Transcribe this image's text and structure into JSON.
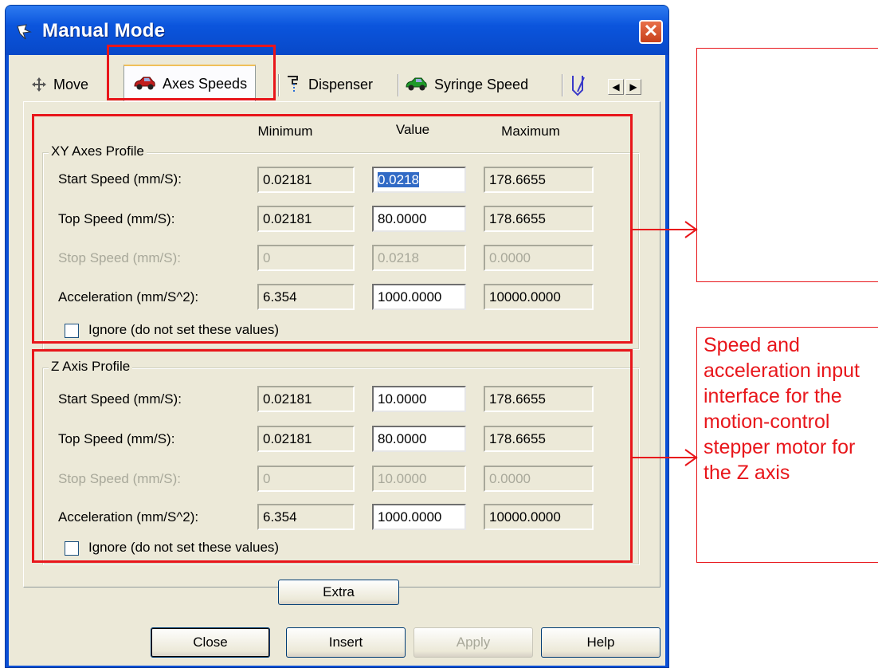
{
  "window": {
    "title": "Manual Mode",
    "close_label": "✕"
  },
  "tabs": [
    {
      "label": "Move",
      "icon": "move-arrows-icon"
    },
    {
      "label": "Axes Speeds",
      "icon": "red-car-icon"
    },
    {
      "label": "Dispenser",
      "icon": "dispenser-icon"
    },
    {
      "label": "Syringe Speed",
      "icon": "green-car-icon"
    }
  ],
  "tab_scroll": {
    "left": "◀",
    "right": "▶"
  },
  "columns": {
    "min": "Minimum",
    "value": "Value",
    "max": "Maximum"
  },
  "xy_profile": {
    "title": "XY Axes Profile",
    "rows": [
      {
        "label": "Start Speed (mm/S):",
        "min": "0.02181",
        "value": "0.0218",
        "max": "178.6655",
        "enabled": true,
        "selected": true
      },
      {
        "label": "Top Speed (mm/S):",
        "min": "0.02181",
        "value": "80.0000",
        "max": "178.6655",
        "enabled": true
      },
      {
        "label": "Stop Speed (mm/S):",
        "min": "0",
        "value": "0.0218",
        "max": "0.0000",
        "enabled": false
      },
      {
        "label": "Acceleration (mm/S^2):",
        "min": "6.354",
        "value": "1000.0000",
        "max": "10000.0000",
        "enabled": true
      }
    ],
    "ignore_label": "Ignore (do not set these values)"
  },
  "z_profile": {
    "title": "Z Axis Profile",
    "rows": [
      {
        "label": "Start Speed (mm/S):",
        "min": "0.02181",
        "value": "10.0000",
        "max": "178.6655",
        "enabled": true
      },
      {
        "label": "Top Speed (mm/S):",
        "min": "0.02181",
        "value": "80.0000",
        "max": "178.6655",
        "enabled": true
      },
      {
        "label": "Stop Speed (mm/S):",
        "min": "0",
        "value": "10.0000",
        "max": "0.0000",
        "enabled": false
      },
      {
        "label": "Acceleration (mm/S^2):",
        "min": "6.354",
        "value": "1000.0000",
        "max": "10000.0000",
        "enabled": true
      }
    ],
    "ignore_label": "Ignore (do not set these values)"
  },
  "buttons": {
    "extra": "Extra",
    "close": "Close",
    "insert": "Insert",
    "apply": "Apply",
    "help": "Help"
  },
  "annotation": {
    "z_note": "Speed and acceleration input interface for the motion-control stepper motor for the Z axis",
    "color": "#e8161b"
  }
}
